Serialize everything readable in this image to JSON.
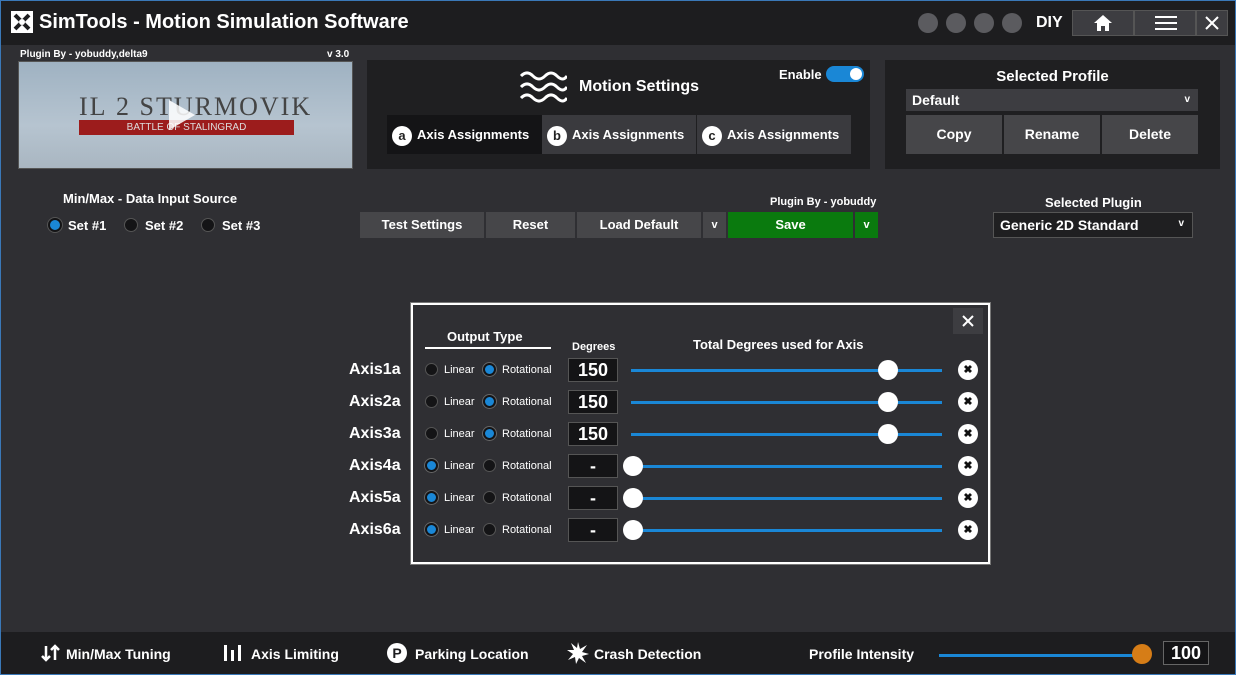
{
  "window": {
    "title": "SimTools - Motion Simulation Software",
    "diy_label": "DIY",
    "title_icons": [
      "upload-icon",
      "crash-icon",
      "edit-icon",
      "power-icon"
    ],
    "home_icon": "home-icon",
    "menu_icon": "menu-icon",
    "close_icon": "close-icon"
  },
  "plugin_preview": {
    "plugin_by": "Plugin By - yobuddy,delta9",
    "version": "v 3.0",
    "game_title": "IL 2 STURMOVIK",
    "game_subtitle": "BATTLE OF STALINGRAD"
  },
  "motion_settings": {
    "title": "Motion Settings",
    "enable_label": "Enable",
    "enabled": true,
    "tabs": [
      {
        "badge": "a",
        "label": "Axis Assignments",
        "active": true
      },
      {
        "badge": "b",
        "label": "Axis Assignments",
        "active": false
      },
      {
        "badge": "c",
        "label": "Axis Assignments",
        "active": false
      }
    ]
  },
  "selected_profile": {
    "title": "Selected Profile",
    "value": "Default",
    "buttons": [
      "Copy",
      "Rename",
      "Delete"
    ]
  },
  "data_input_source": {
    "title": "Min/Max - Data Input Source",
    "options": [
      {
        "label": "Set #1",
        "selected": true
      },
      {
        "label": "Set #2",
        "selected": false
      },
      {
        "label": "Set #3",
        "selected": false
      }
    ]
  },
  "toolbar": {
    "plugin_by": "Plugin By - yobuddy",
    "test_settings": "Test Settings",
    "reset": "Reset",
    "load_default": "Load Default",
    "dropdown": "v",
    "save": "Save",
    "save_dropdown": "v"
  },
  "selected_plugin": {
    "title": "Selected Plugin",
    "value": "Generic 2D Standard"
  },
  "axis_panel": {
    "output_type_label": "Output Type",
    "degrees_label": "Degrees",
    "total_label": "Total Degrees used for Axis",
    "linear_label": "Linear",
    "rotational_label": "Rotational",
    "axes": [
      {
        "name": "Axis1a",
        "type": "rotational",
        "degrees": "150",
        "slider": 0.83
      },
      {
        "name": "Axis2a",
        "type": "rotational",
        "degrees": "150",
        "slider": 0.83
      },
      {
        "name": "Axis3a",
        "type": "rotational",
        "degrees": "150",
        "slider": 0.83
      },
      {
        "name": "Axis4a",
        "type": "linear",
        "degrees": "-",
        "slider": 0.0
      },
      {
        "name": "Axis5a",
        "type": "linear",
        "degrees": "-",
        "slider": 0.0
      },
      {
        "name": "Axis6a",
        "type": "linear",
        "degrees": "-",
        "slider": 0.0
      }
    ]
  },
  "bottom_bar": {
    "minmax_tuning": "Min/Max Tuning",
    "axis_limiting": "Axis Limiting",
    "parking_location": "Parking Location",
    "crash_detection": "Crash Detection",
    "profile_intensity": "Profile Intensity",
    "intensity_value": "100",
    "intensity_fraction": 1.0
  },
  "colors": {
    "accent": "#1a87d6",
    "save_green": "#0a7a0e",
    "intensity_orange": "#d67d17"
  }
}
